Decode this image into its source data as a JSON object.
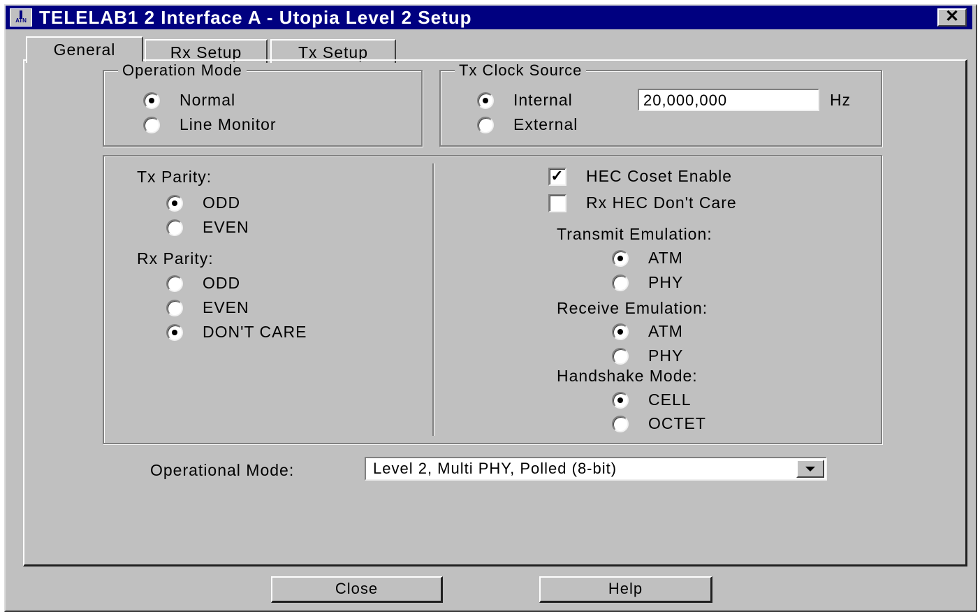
{
  "window": {
    "title": "TELELAB1 2 Interface A - Utopia Level 2 Setup",
    "app_icon_label": "ATN",
    "close_label": "✕"
  },
  "tabs": [
    {
      "label": "General",
      "active": true
    },
    {
      "label": "Rx Setup",
      "active": false
    },
    {
      "label": "Tx Setup",
      "active": false
    }
  ],
  "operation_mode": {
    "legend": "Operation Mode",
    "options": [
      {
        "label": "Normal",
        "checked": true
      },
      {
        "label": "Line Monitor",
        "checked": false
      }
    ]
  },
  "tx_clock_source": {
    "legend": "Tx Clock Source",
    "options": [
      {
        "label": "Internal",
        "checked": true
      },
      {
        "label": "External",
        "checked": false
      }
    ],
    "frequency_value": "20,000,000",
    "frequency_unit": "Hz"
  },
  "parity": {
    "tx_label": "Tx Parity:",
    "tx_options": [
      {
        "label": "ODD",
        "checked": true
      },
      {
        "label": "EVEN",
        "checked": false
      }
    ],
    "rx_label": "Rx Parity:",
    "rx_options": [
      {
        "label": "ODD",
        "checked": false
      },
      {
        "label": "EVEN",
        "checked": false
      },
      {
        "label": "DON'T CARE",
        "checked": true
      }
    ]
  },
  "hec": {
    "coset_label": "HEC Coset Enable",
    "coset_checked": true,
    "rx_dont_care_label": "Rx HEC Don't Care",
    "rx_dont_care_checked": false
  },
  "emulation": {
    "transmit_label": "Transmit Emulation:",
    "transmit_options": [
      {
        "label": "ATM",
        "checked": true
      },
      {
        "label": "PHY",
        "checked": false
      }
    ],
    "receive_label": "Receive Emulation:",
    "receive_options": [
      {
        "label": "ATM",
        "checked": true
      },
      {
        "label": "PHY",
        "checked": false
      }
    ],
    "handshake_label": "Handshake Mode:",
    "handshake_options": [
      {
        "label": "CELL",
        "checked": true
      },
      {
        "label": "OCTET",
        "checked": false
      }
    ]
  },
  "operational_mode": {
    "label": "Operational Mode:",
    "value": "Level 2, Multi PHY, Polled (8-bit)"
  },
  "buttons": {
    "close": "Close",
    "help": "Help"
  }
}
